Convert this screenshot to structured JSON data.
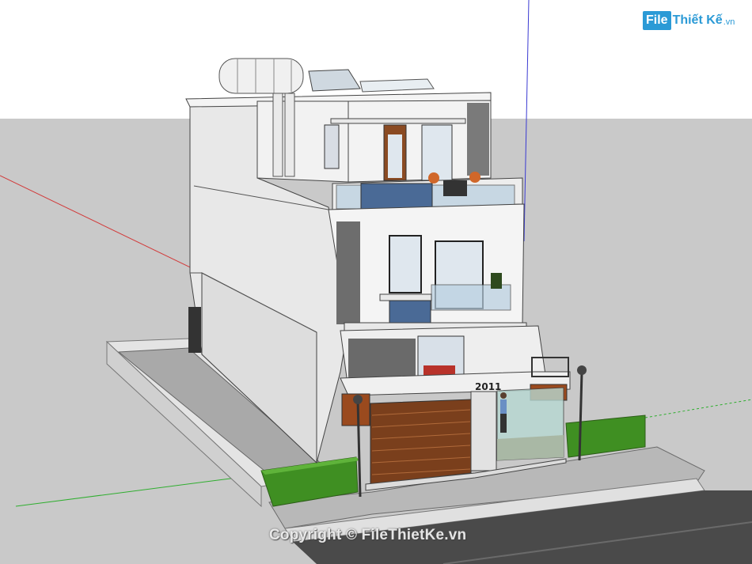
{
  "watermark": {
    "logo_box": "File",
    "logo_text": "Thiết Kế",
    "logo_suffix": ".vn",
    "copyright": "Copyright © FileThietKe.vn"
  },
  "house": {
    "number_plate": "2011"
  },
  "colors": {
    "sky": "#ffffff",
    "ground": "#c9c9c9",
    "wall": "#f2f2f2",
    "wall_shade": "#dcdcdc",
    "road": "#4a4a4a",
    "gate_wood": "#8a4a22",
    "hedge": "#3f8f22",
    "glass_blue": "#4a6a96"
  }
}
